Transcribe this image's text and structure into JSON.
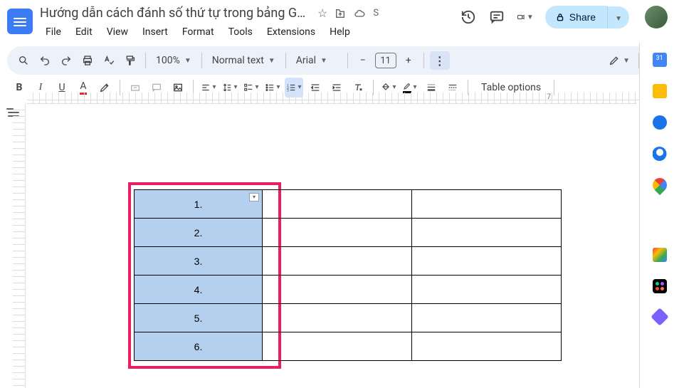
{
  "header": {
    "doc_title": "Hướng dẫn cách đánh số thứ tự trong bảng Go...",
    "save_status": "S",
    "menus": [
      "File",
      "Edit",
      "View",
      "Insert",
      "Format",
      "Tools",
      "Extensions",
      "Help"
    ],
    "share_label": "Share"
  },
  "toolbar1": {
    "zoom": "100%",
    "style": "Normal text",
    "font": "Arial",
    "font_size": "11"
  },
  "toolbar2": {
    "table_options": "Table options"
  },
  "ruler": {
    "mark": "7"
  },
  "table": {
    "rows": [
      "1.",
      "2.",
      "3.",
      "4.",
      "5.",
      "6."
    ]
  }
}
